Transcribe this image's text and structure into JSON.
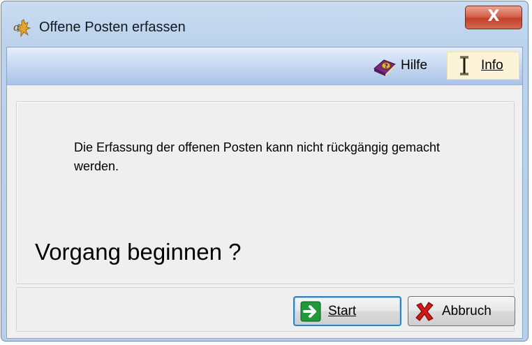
{
  "window": {
    "title": "Offene Posten erfassen",
    "close_glyph": "X"
  },
  "toolbar": {
    "hilfe_label": "Hilfe",
    "info_label": "Info",
    "hilfe_icon": "help-book-icon",
    "info_icon": "text-cursor-icon"
  },
  "content": {
    "message": "Die Erfassung der offenen Posten kann nicht rückgängig gemacht werden.",
    "question": "Vorgang beginnen ?"
  },
  "buttons": {
    "start_label": "Start",
    "start_icon": "arrow-right-icon",
    "abbruch_label": "Abbruch",
    "abbruch_icon": "red-x-icon"
  },
  "colors": {
    "start_arrow": "#1f9a3a",
    "cancel_x": "#d01818",
    "close_button": "#c9503a"
  }
}
